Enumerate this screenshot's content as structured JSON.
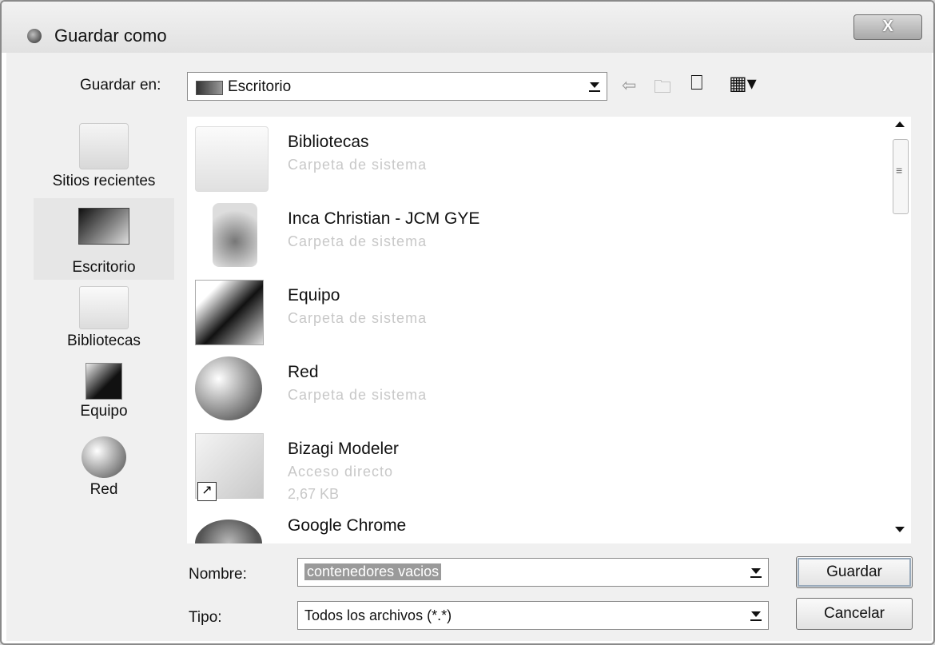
{
  "window": {
    "title": "Guardar como",
    "close_label": "X"
  },
  "location": {
    "label": "Guardar en:",
    "value": "Escritorio"
  },
  "toolbar": {
    "back_icon": "back-arrow-icon",
    "up_icon": "up-folder-icon",
    "new_folder_icon": "new-folder-icon",
    "views_icon": "views-menu-icon"
  },
  "places": [
    {
      "label": "Sitios recientes",
      "icon": "recent-places-icon"
    },
    {
      "label": "Escritorio",
      "icon": "desktop-icon",
      "selected": true
    },
    {
      "label": "Bibliotecas",
      "icon": "libraries-icon"
    },
    {
      "label": "Equipo",
      "icon": "computer-icon"
    },
    {
      "label": "Red",
      "icon": "network-icon"
    }
  ],
  "files": [
    {
      "name": "Bibliotecas",
      "type": "Carpeta de sistema",
      "size": ""
    },
    {
      "name": "Inca Christian - JCM GYE",
      "type": "Carpeta de sistema",
      "size": ""
    },
    {
      "name": "Equipo",
      "type": "Carpeta de sistema",
      "size": ""
    },
    {
      "name": "Red",
      "type": "Carpeta de sistema",
      "size": ""
    },
    {
      "name": "Bizagi Modeler",
      "type": "Acceso directo",
      "size": "2,67 KB"
    },
    {
      "name": "Google Chrome",
      "type": "",
      "size": ""
    }
  ],
  "filename": {
    "label": "Nombre:",
    "value": "contenedores vacios"
  },
  "filetype": {
    "label": "Tipo:",
    "value": "Todos los archivos (*.*)"
  },
  "buttons": {
    "save": "Guardar",
    "cancel": "Cancelar"
  }
}
